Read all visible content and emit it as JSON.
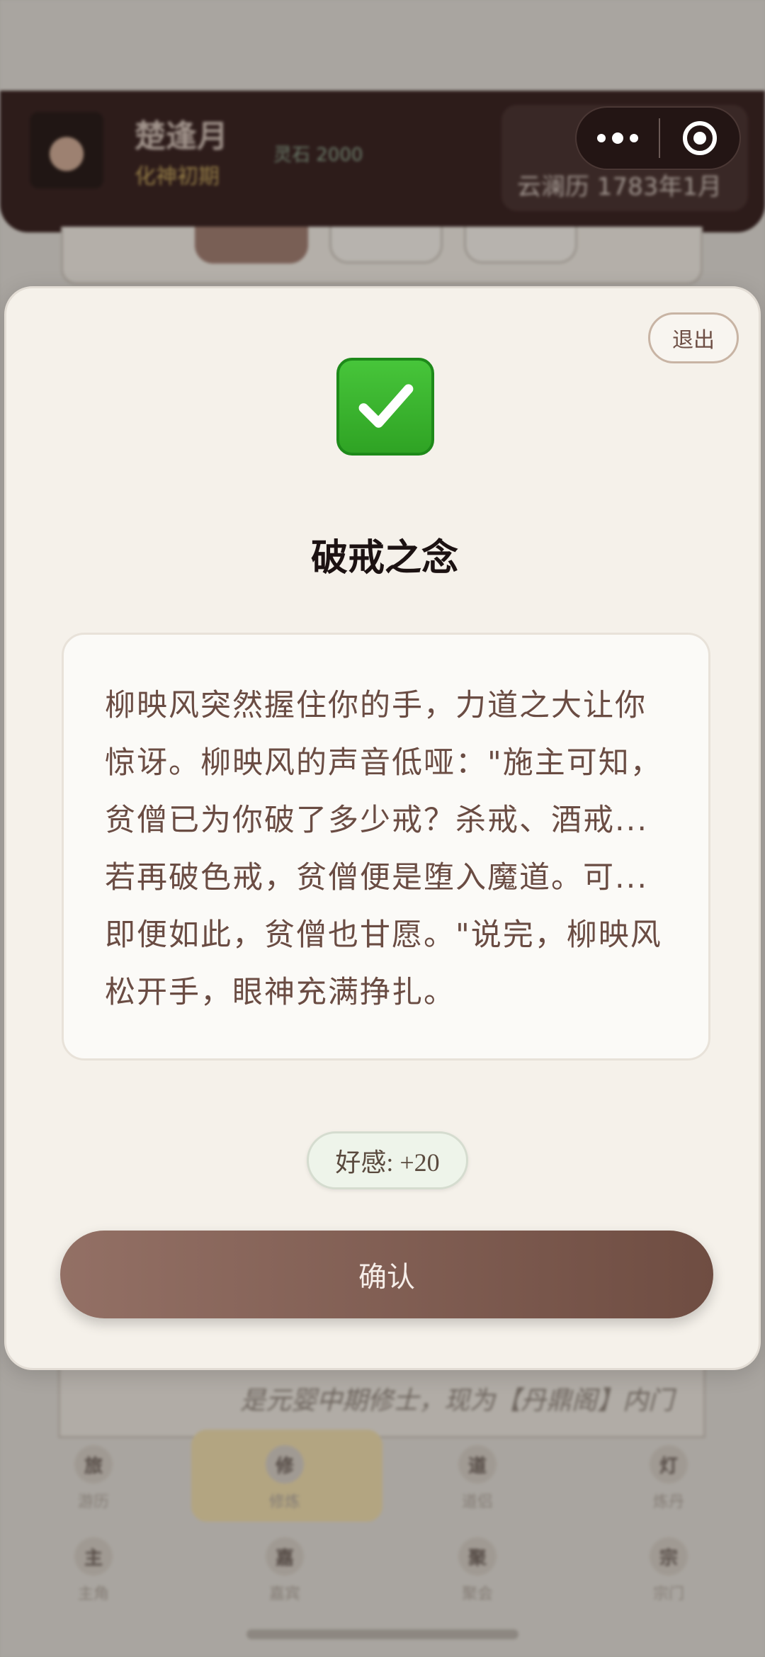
{
  "background": {
    "profile_name": "楚逢月",
    "profile_subtitle": "化神初期",
    "money_text": "灵石 2000",
    "right_panel_text": "云澜历 1783年1月",
    "lower_card_text": "是元婴中期修士，现为【丹鼎阁】内门",
    "grid_row1": [
      {
        "icon": "旅",
        "label": "游历"
      },
      {
        "icon": "修",
        "label": "修炼"
      },
      {
        "icon": "道",
        "label": "道侣"
      },
      {
        "icon": "灯",
        "label": "炼丹"
      }
    ],
    "grid_row2": [
      {
        "icon": "主",
        "label": "主角"
      },
      {
        "icon": "嘉",
        "label": "嘉宾"
      },
      {
        "icon": "聚",
        "label": "聚会"
      },
      {
        "icon": "宗",
        "label": "宗门"
      }
    ]
  },
  "modal": {
    "exit_label": "退出",
    "check_icon": "check-mark-button-icon",
    "title": "破戒之念",
    "story": "柳映风突然握住你的手，力道之大让你惊讶。柳映风的声音低哑：\"施主可知，贫僧已为你破了多少戒？杀戒、酒戒...若再破色戒，贫僧便是堕入魔道。可...即便如此，贫僧也甘愿。\"说完，柳映风松开手，眼神充满挣扎。",
    "favor_label": "好感: +20",
    "confirm_label": "确认"
  },
  "colors": {
    "modal_bg": "#f5f1ea",
    "text_brown": "#6a4c43",
    "confirm_start": "#937065",
    "confirm_end": "#6f4d42",
    "check_green": "#3bb52e"
  }
}
